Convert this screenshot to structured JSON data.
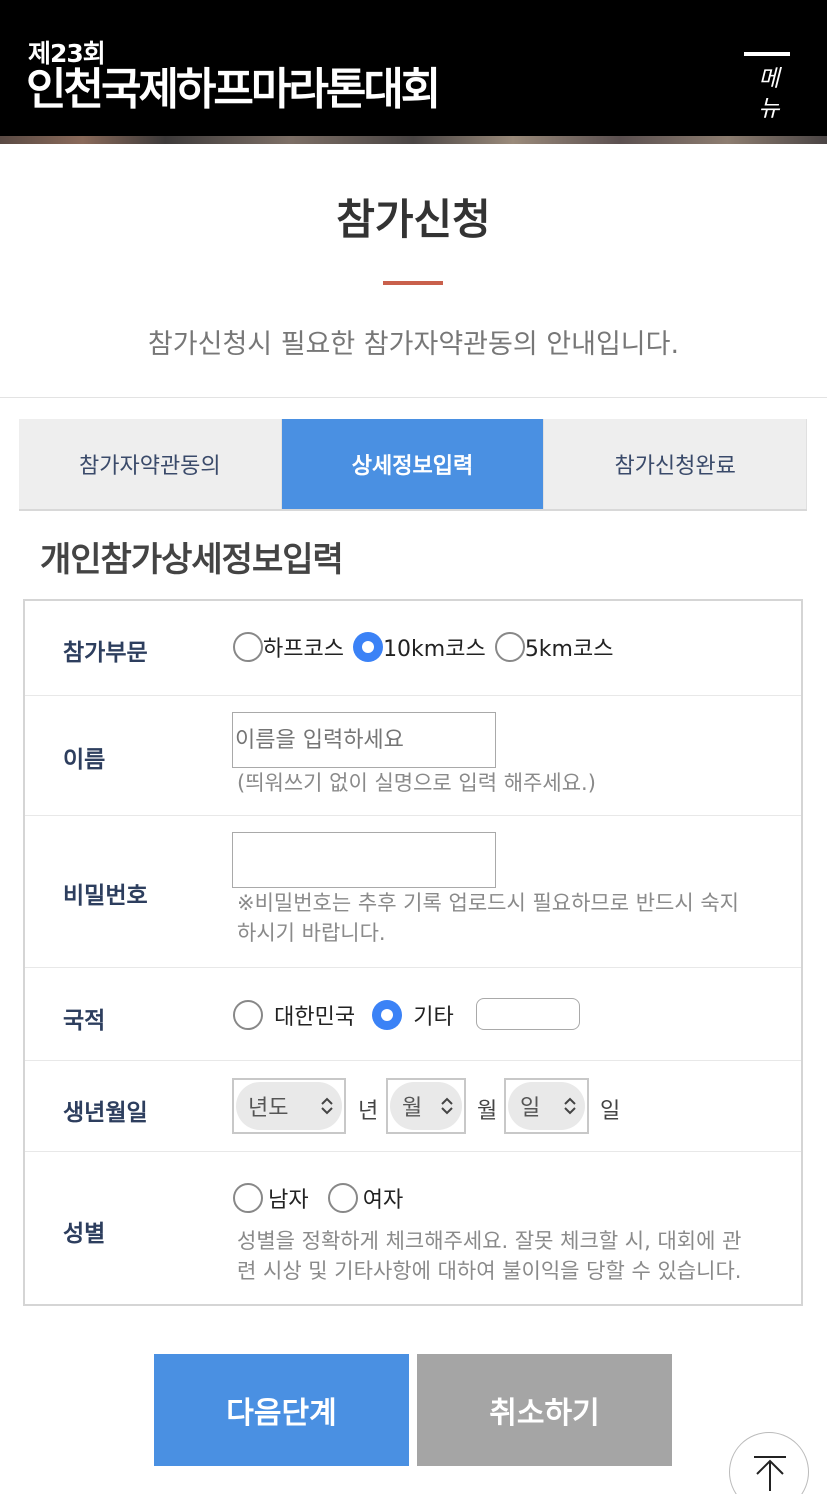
{
  "header": {
    "edition": "제23회",
    "title": "인천국제하프마라톤대회",
    "menu_label_1": "메",
    "menu_label_2": "뉴"
  },
  "page": {
    "title": "참가신청",
    "description": "참가신청시 필요한 참가자약관동의 안내입니다."
  },
  "tabs": [
    {
      "label": "참가자약관동의",
      "active": false
    },
    {
      "label": "상세정보입력",
      "active": true
    },
    {
      "label": "참가신청완료",
      "active": false
    }
  ],
  "section_title": "개인참가상세정보입력",
  "form": {
    "division": {
      "label": "참가부문",
      "options": [
        "하프코스",
        "10km코스",
        "5km코스"
      ],
      "selected": "10km코스"
    },
    "name": {
      "label": "이름",
      "placeholder": "이름을 입력하세요",
      "hint": "(띄워쓰기 없이 실명으로 입력 해주세요.)"
    },
    "password": {
      "label": "비밀번호",
      "hint_line1": "※비밀번호는 추후 기록 업로드시 필요하므로 반드시 숙지",
      "hint_line2": "하시기 바랍니다."
    },
    "nationality": {
      "label": "국적",
      "options": [
        "대한민국",
        "기타"
      ],
      "selected": "기타"
    },
    "birthdate": {
      "label": "생년월일",
      "year_select": "년도",
      "year_unit": "년",
      "month_select": "월",
      "month_unit": "월",
      "day_select": "일",
      "day_unit": "일"
    },
    "gender": {
      "label": "성별",
      "options": [
        "남자",
        "여자"
      ],
      "hint_line1": "성별을 정확하게 체크해주세요. 잘못 체크할 시, 대회에 관",
      "hint_line2": "련 시상 및 기타사항에 대하여 불이익을 당할 수 있습니다."
    }
  },
  "buttons": {
    "next": "다음단계",
    "cancel": "취소하기"
  },
  "colors": {
    "accent_blue": "#4a90e2",
    "title_bar": "#c9604c",
    "header_bg": "#000000"
  }
}
